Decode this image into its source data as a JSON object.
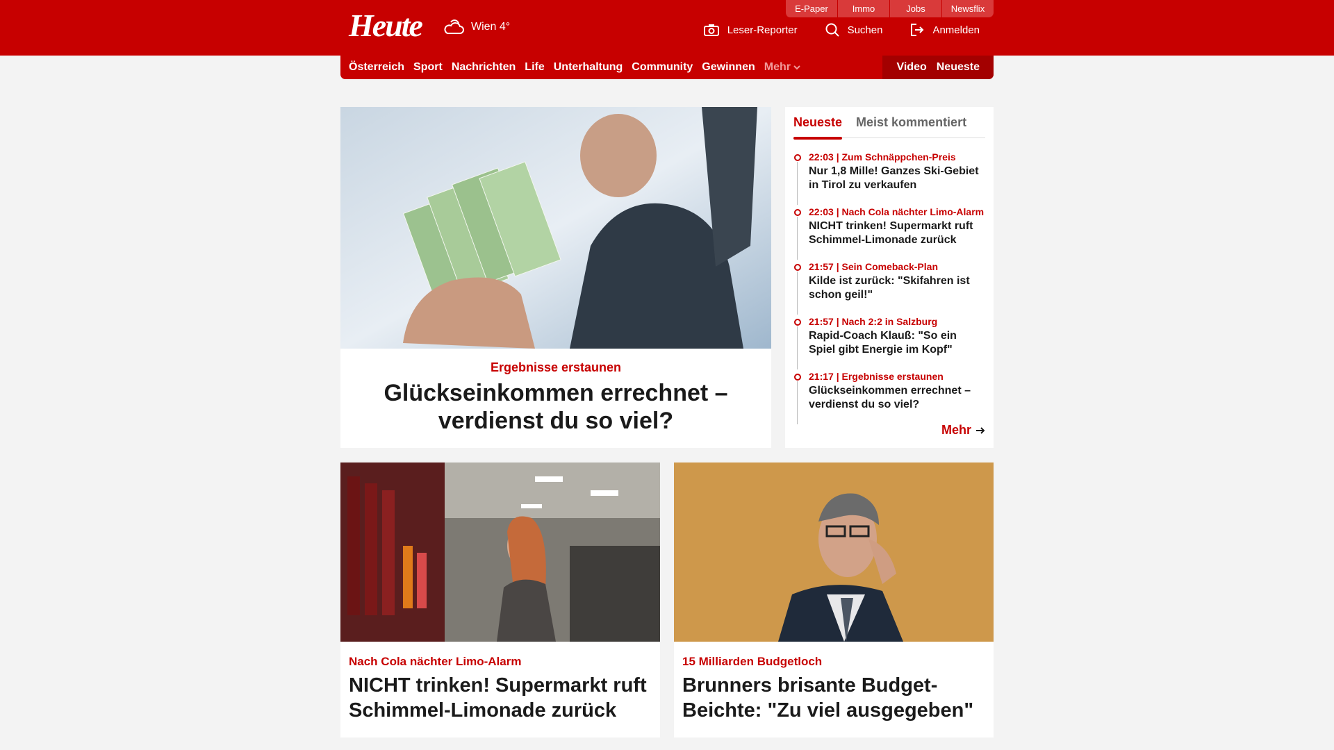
{
  "header": {
    "logo": "Heute",
    "weather": "Wien 4°",
    "quick_links": [
      "E-Paper",
      "Immo",
      "Jobs",
      "Newsflix"
    ],
    "actions": {
      "reporter": "Leser-Reporter",
      "search": "Suchen",
      "login": "Anmelden"
    }
  },
  "nav": {
    "items": [
      "Österreich",
      "Sport",
      "Nachrichten",
      "Life",
      "Unterhaltung",
      "Community",
      "Gewinnen"
    ],
    "more": "Mehr",
    "right": [
      "Video",
      "Neueste"
    ]
  },
  "hero": {
    "kicker": "Ergebnisse erstaunen",
    "title": "Glückseinkommen errechnet – verdienst du so viel?"
  },
  "sidebar": {
    "tabs": [
      "Neueste",
      "Meist kommentiert"
    ],
    "items": [
      {
        "meta": "22:03 | Zum Schnäppchen-Preis",
        "title": "Nur 1,8 Mille! Ganzes Ski-Gebiet in Tirol zu verkaufen"
      },
      {
        "meta": "22:03 | Nach Cola nächter Limo-Alarm",
        "title": "NICHT trinken! Supermarkt ruft Schimmel-Limonade zurück"
      },
      {
        "meta": "21:57 | Sein Comeback-Plan",
        "title": "Kilde ist zurück: \"Skifahren ist schon geil!\""
      },
      {
        "meta": "21:57 | Nach 2:2 in Salzburg",
        "title": "Rapid-Coach Klauß: \"So ein Spiel gibt Energie im Kopf\""
      },
      {
        "meta": "21:17 | Ergebnisse erstaunen",
        "title": "Glückseinkommen errechnet – verdienst du so viel?"
      }
    ],
    "more": "Mehr"
  },
  "cards": [
    {
      "kicker": "Nach Cola nächter Limo-Alarm",
      "title": "NICHT trinken! Supermarkt ruft Schimmel-Limonade zurück"
    },
    {
      "kicker": "15 Milliarden Budgetloch",
      "title": "Brunners brisante Budget-Beichte: \"Zu viel ausgegeben\""
    }
  ],
  "colors": {
    "brand": "#c70000",
    "background": "#f3f3f3"
  }
}
